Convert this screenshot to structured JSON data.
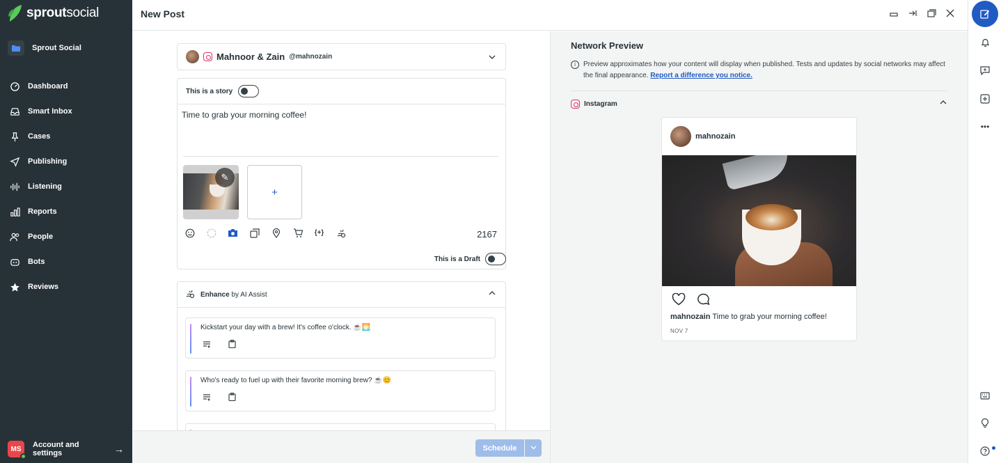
{
  "brand": {
    "name_bold": "sprout",
    "name_thin": "social"
  },
  "workspace": {
    "label": "Sprout Social"
  },
  "nav": [
    {
      "label": "Dashboard",
      "icon": "dashboard-icon"
    },
    {
      "label": "Smart Inbox",
      "icon": "inbox-icon"
    },
    {
      "label": "Cases",
      "icon": "pin-icon"
    },
    {
      "label": "Publishing",
      "icon": "send-icon"
    },
    {
      "label": "Listening",
      "icon": "listening-icon"
    },
    {
      "label": "Reports",
      "icon": "reports-icon"
    },
    {
      "label": "People",
      "icon": "people-icon"
    },
    {
      "label": "Bots",
      "icon": "bot-icon"
    },
    {
      "label": "Reviews",
      "icon": "star-icon"
    }
  ],
  "account": {
    "initials": "MS",
    "label": "Account and settings"
  },
  "header": {
    "title": "New Post"
  },
  "profile": {
    "name": "Mahnoor & Zain",
    "handle": "@mahnozain"
  },
  "composer": {
    "story_label": "This is a story",
    "text": "Time to grab your morning coffee!",
    "char_count": "2167",
    "add_media": "+",
    "draft_label": "This is a Draft"
  },
  "ai": {
    "title_bold": "Enhance",
    "title_rest": " by AI Assist",
    "suggestions": [
      "Kickstart your day with a brew! It's coffee o'clock. ☕🌅",
      "Who's ready to fuel up with their favorite morning brew? ☕😊"
    ]
  },
  "footer": {
    "schedule_label": "Schedule"
  },
  "preview": {
    "title": "Network Preview",
    "info_text": "Preview approximates how your content will display when published. Tests and updates by social networks may affect the final appearance. ",
    "info_link": "Report a difference you notice.",
    "network": "Instagram",
    "username": "mahnozain",
    "caption": "Time to grab your morning coffee!",
    "date": "NOV 7"
  },
  "colors": {
    "sidebar": "#273238",
    "accent": "#205bc3",
    "instagram": "#e1306c",
    "brand_green": "#59cb59"
  }
}
